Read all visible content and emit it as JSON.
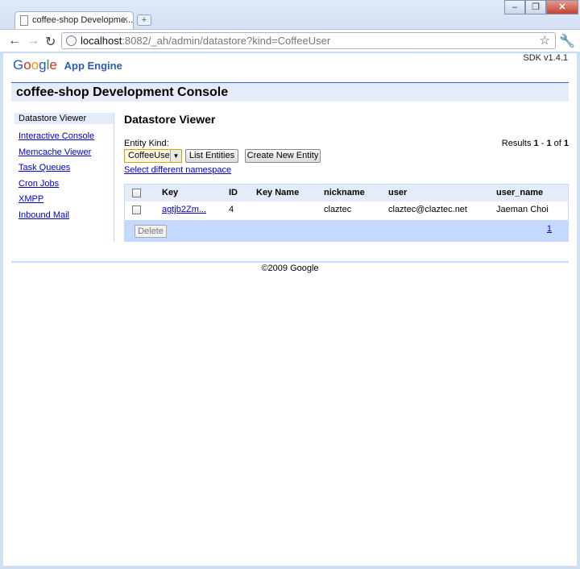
{
  "browser": {
    "tab_title": "coffee-shop Developme...",
    "tab_close": "×",
    "new_tab": "+",
    "window_buttons": [
      "–",
      "❐",
      "✕"
    ],
    "back": "←",
    "forward": "→",
    "reload": "↻",
    "url_host": "localhost",
    "url_rest": ":8082/_ah/admin/datastore?kind=CoffeeUser",
    "star": "☆",
    "wrench": "🔧",
    "icons": [
      "page-icon",
      "back-icon",
      "forward-icon",
      "reload-icon",
      "globe-icon",
      "star-icon",
      "wrench-icon"
    ]
  },
  "header": {
    "logo_letters": [
      "G",
      "o",
      "o",
      "g",
      "l",
      "e"
    ],
    "product": "App Engine",
    "sdk_version": "SDK v1.4.1",
    "console_title": "coffee-shop Development Console"
  },
  "sidebar": {
    "items": [
      {
        "label": "Datastore Viewer",
        "active": true
      },
      {
        "label": "Interactive Console"
      },
      {
        "label": "Memcache Viewer"
      },
      {
        "label": "Task Queues"
      },
      {
        "label": "Cron Jobs"
      },
      {
        "label": "XMPP"
      },
      {
        "label": "Inbound Mail"
      }
    ]
  },
  "main": {
    "title": "Datastore Viewer",
    "entity_kind_label": "Entity Kind:",
    "entity_kind_value": "CoffeeUser",
    "list_entities": "List Entities",
    "create_entity": "Create New Entity",
    "namespace_link": "Select different namespace",
    "results": {
      "prefix": "Results ",
      "from": "1",
      "sep": " - ",
      "to": "1",
      "of": " of ",
      "total": "1"
    },
    "table": {
      "columns": [
        "Key",
        "ID",
        "Key Name",
        "nickname",
        "user",
        "user_name"
      ],
      "rows": [
        {
          "key": "agtjb2Zm...",
          "id": "4",
          "key_name": "",
          "nickname": "claztec",
          "user": "claztec@claztec.net",
          "user_name": "Jaeman Choi"
        }
      ],
      "delete_label": "Delete",
      "page": "1"
    }
  },
  "footer": {
    "copyright": "©2009 Google"
  },
  "colors": {
    "nav_link": "#0000cc",
    "console_bar": "#e5ecf9",
    "table_footer": "#c3d9ff",
    "accent_line": "#3366cc"
  }
}
